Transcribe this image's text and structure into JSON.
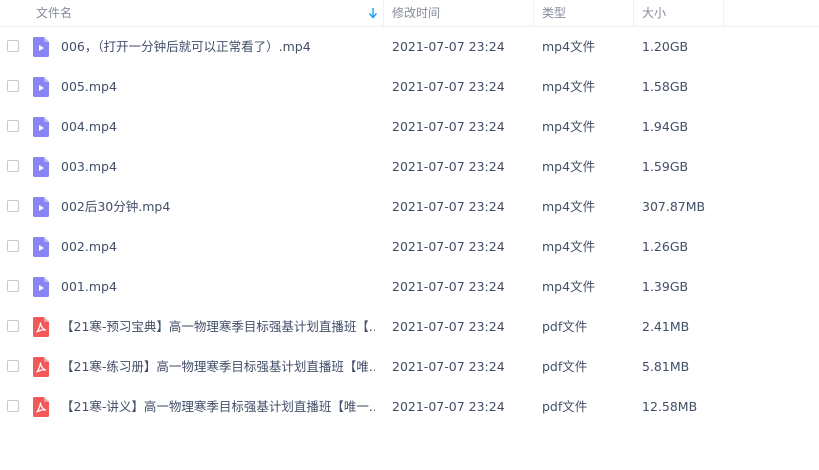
{
  "header": {
    "name_label": "文件名",
    "date_label": "修改时间",
    "type_label": "类型",
    "size_label": "大小"
  },
  "files": [
    {
      "name": "006，（打开一分钟后就可以正常看了）.mp4",
      "date": "2021-07-07 23:24",
      "type": "mp4文件",
      "size": "1.20GB",
      "icon": "video-file-icon"
    },
    {
      "name": "005.mp4",
      "date": "2021-07-07 23:24",
      "type": "mp4文件",
      "size": "1.58GB",
      "icon": "video-file-icon"
    },
    {
      "name": "004.mp4",
      "date": "2021-07-07 23:24",
      "type": "mp4文件",
      "size": "1.94GB",
      "icon": "video-file-icon"
    },
    {
      "name": "003.mp4",
      "date": "2021-07-07 23:24",
      "type": "mp4文件",
      "size": "1.59GB",
      "icon": "video-file-icon"
    },
    {
      "name": "002后30分钟.mp4",
      "date": "2021-07-07 23:24",
      "type": "mp4文件",
      "size": "307.87MB",
      "icon": "video-file-icon"
    },
    {
      "name": "002.mp4",
      "date": "2021-07-07 23:24",
      "type": "mp4文件",
      "size": "1.26GB",
      "icon": "video-file-icon"
    },
    {
      "name": "001.mp4",
      "date": "2021-07-07 23:24",
      "type": "mp4文件",
      "size": "1.39GB",
      "icon": "video-file-icon"
    },
    {
      "name": "【21寒-预习宝典】高一物理寒季目标强基计划直播班【...",
      "date": "2021-07-07 23:24",
      "type": "pdf文件",
      "size": "2.41MB",
      "icon": "pdf-file-icon"
    },
    {
      "name": "【21寒-练习册】高一物理寒季目标强基计划直播班【唯...",
      "date": "2021-07-07 23:24",
      "type": "pdf文件",
      "size": "5.81MB",
      "icon": "pdf-file-icon"
    },
    {
      "name": "【21寒-讲义】高一物理寒季目标强基计划直播班【唯一...",
      "date": "2021-07-07 23:24",
      "type": "pdf文件",
      "size": "12.58MB",
      "icon": "pdf-file-icon"
    }
  ],
  "colors": {
    "video_icon": "#8a85f5",
    "pdf_icon": "#f25a5a",
    "sort_arrow": "#1e9ef5"
  }
}
